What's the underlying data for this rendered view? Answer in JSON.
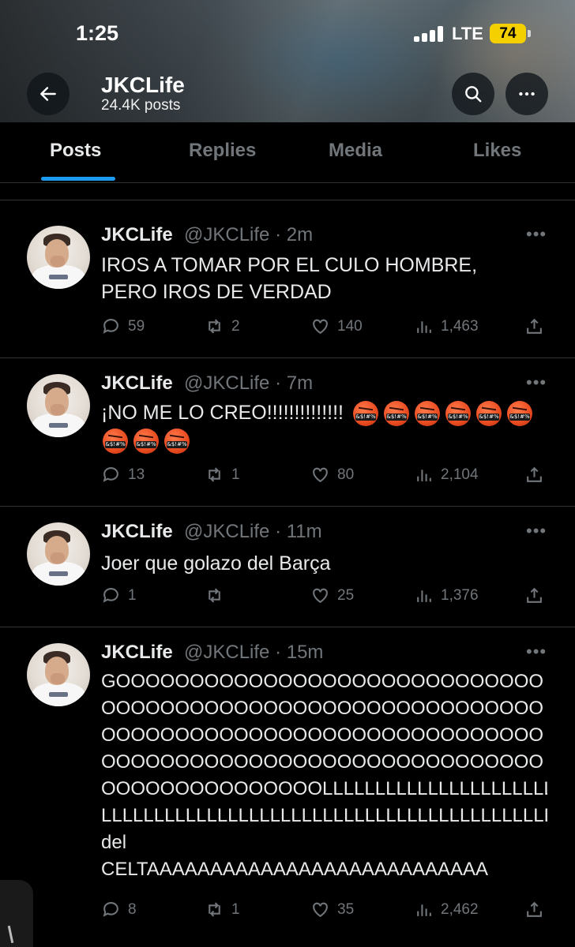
{
  "status_bar": {
    "time": "1:25",
    "network": "LTE",
    "battery": "74"
  },
  "header": {
    "name": "JKCLife",
    "post_count": "24.4K posts"
  },
  "tabs": [
    {
      "label": "Posts",
      "active": true
    },
    {
      "label": "Replies",
      "active": false
    },
    {
      "label": "Media",
      "active": false
    },
    {
      "label": "Likes",
      "active": false
    }
  ],
  "tweets": [
    {
      "name": "JKCLife",
      "handle": "@JKCLife",
      "time": "2m",
      "text": "IROS A TOMAR POR EL CULO HOMBRE, PERO IROS DE VERDAD",
      "replies": "59",
      "retweets": "2",
      "likes": "140",
      "views": "1,463"
    },
    {
      "name": "JKCLife",
      "handle": "@JKCLife",
      "time": "7m",
      "text": "¡NO ME LO CREO!!!!!!!!!!!!!!",
      "emoji_count": 9,
      "emoji_label": "&$!#%",
      "replies": "13",
      "retweets": "1",
      "likes": "80",
      "views": "2,104"
    },
    {
      "name": "JKCLife",
      "handle": "@JKCLife",
      "time": "11m",
      "text": "Joer que golazo del Barça",
      "replies": "1",
      "retweets": "",
      "likes": "25",
      "views": "1,376"
    },
    {
      "name": "JKCLife",
      "handle": "@JKCLife",
      "time": "15m",
      "text_lines": [
        "GOOOOOOOOOOOOOOOOOOOOOOOOOOOOO",
        "OOOOOOOOOOOOOOOOOOOOOOOOOOOOOO",
        "OOOOOOOOOOOOOOOOOOOOOOOOOOOOOO",
        "OOOOOOOOOOOOOOOOOOOOOOOOOOOOOO",
        "OOOOOOOOOOOOOOOLLLLLLLLLLLLLLLLLLLLLL",
        "LLLLLLLLLLLLLLLLLLLLLLLLLLLLLLLLLLLLLLLLLLLLLLLLLLL",
        "del",
        "CELTAAAAAAAAAAAAAAAAAAAAAAAAAAA"
      ],
      "replies": "8",
      "retweets": "1",
      "likes": "35",
      "views": "2,462"
    }
  ],
  "icons": {
    "back": "arrow-left-icon",
    "search": "search-icon",
    "more": "more-icon",
    "reply": "reply-icon",
    "retweet": "retweet-icon",
    "like": "heart-icon",
    "views": "views-icon",
    "share": "share-icon"
  },
  "colors": {
    "accent": "#1d9bf0",
    "muted": "#71767b",
    "text": "#e7e9ea",
    "battery": "#f5d000"
  }
}
